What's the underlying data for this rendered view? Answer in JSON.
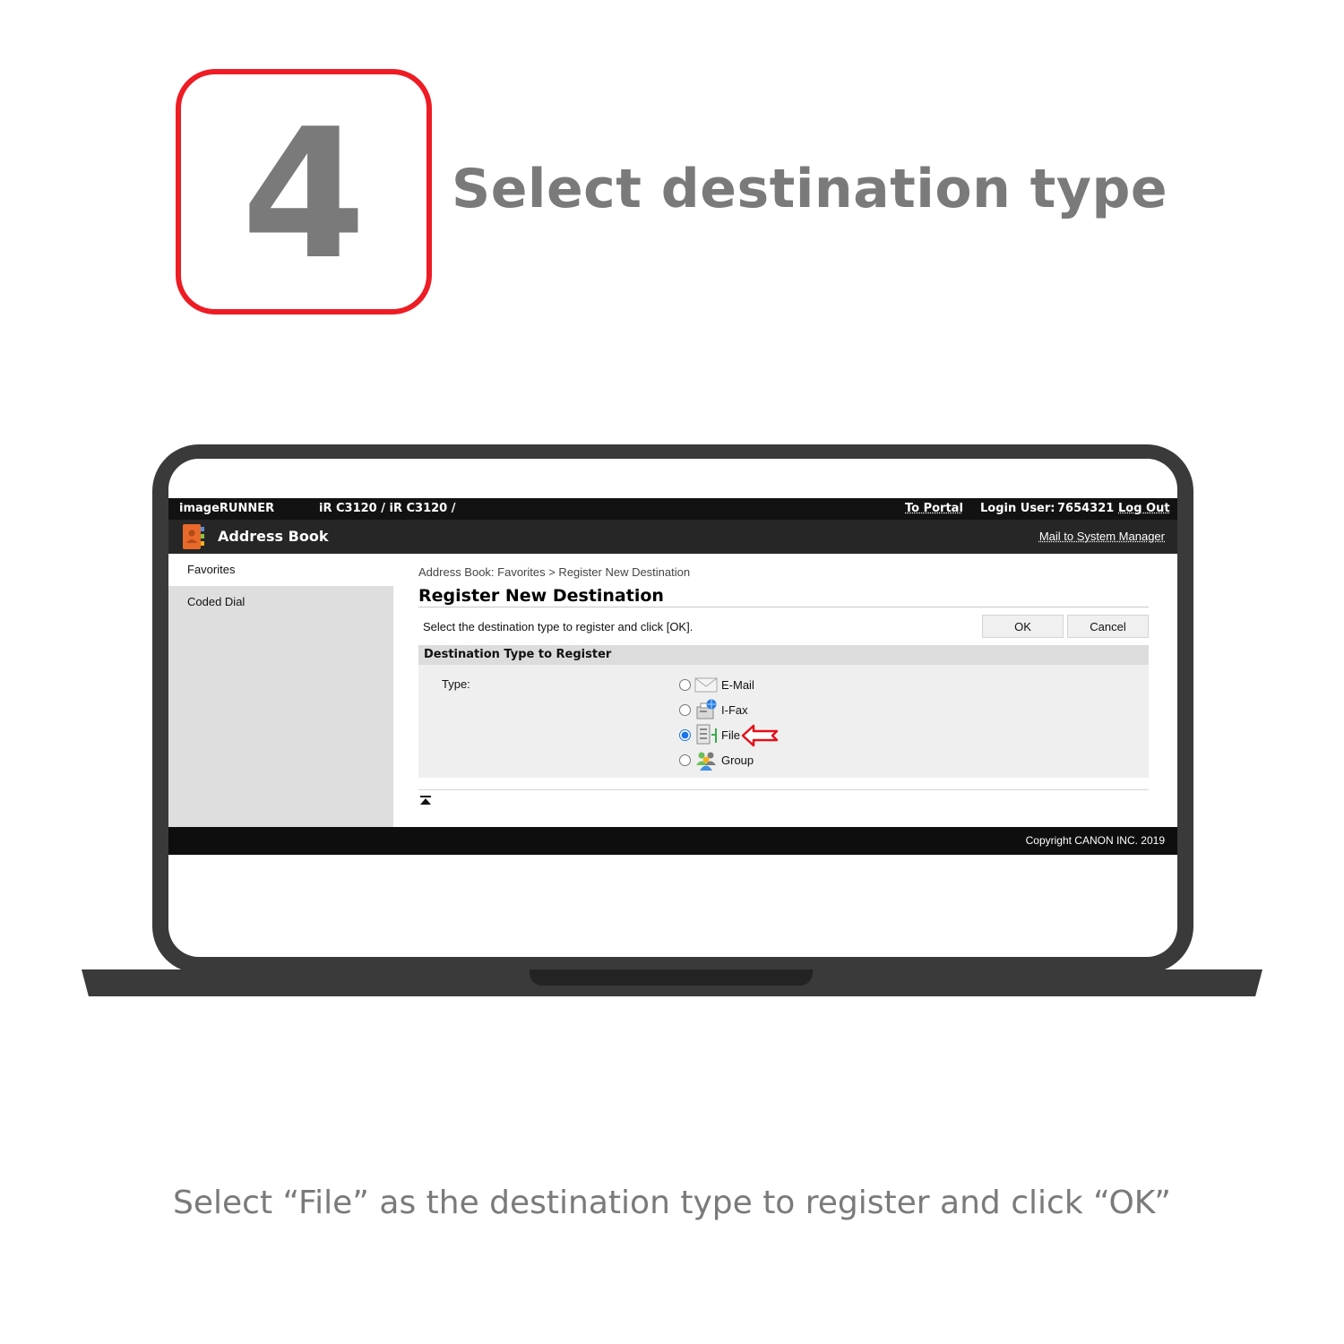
{
  "step": {
    "number": "4",
    "title": "Select destination type",
    "caption": "Select “File” as the destination type to register and click “OK”"
  },
  "app": {
    "product": "imageRUNNER",
    "model": "iR C3120 / iR C3120 /",
    "to_portal": "To Portal",
    "login_label": "Login User:",
    "login_user": "7654321",
    "logout": "Log Out",
    "title": "Address Book",
    "mail_link": "Mail to System Manager",
    "sidebar": [
      {
        "label": "Favorites",
        "active": true
      },
      {
        "label": "Coded Dial",
        "active": false
      }
    ],
    "breadcrumb": "Address Book: Favorites > Register New Destination",
    "page_title": "Register New Destination",
    "instruction": "Select the destination type to register and click [OK].",
    "ok_label": "OK",
    "cancel_label": "Cancel",
    "section_title": "Destination Type to Register",
    "type_label": "Type:",
    "types": [
      {
        "label": "E-Mail",
        "icon": "envelope-icon",
        "selected": false
      },
      {
        "label": "I-Fax",
        "icon": "ifax-icon",
        "selected": false
      },
      {
        "label": "File",
        "icon": "file-server-icon",
        "selected": true
      },
      {
        "label": "Group",
        "icon": "group-icon",
        "selected": false
      }
    ],
    "copyright": "Copyright CANON INC. 2019"
  },
  "colors": {
    "step_border": "#ee1c24",
    "step_text": "#7a7a7a",
    "laptop": "#3a3a3a",
    "top_bar": "#121212",
    "title_bar": "#262626",
    "sidebar": "#dedede",
    "section": "#efefef",
    "arrow": "#e3101a"
  }
}
